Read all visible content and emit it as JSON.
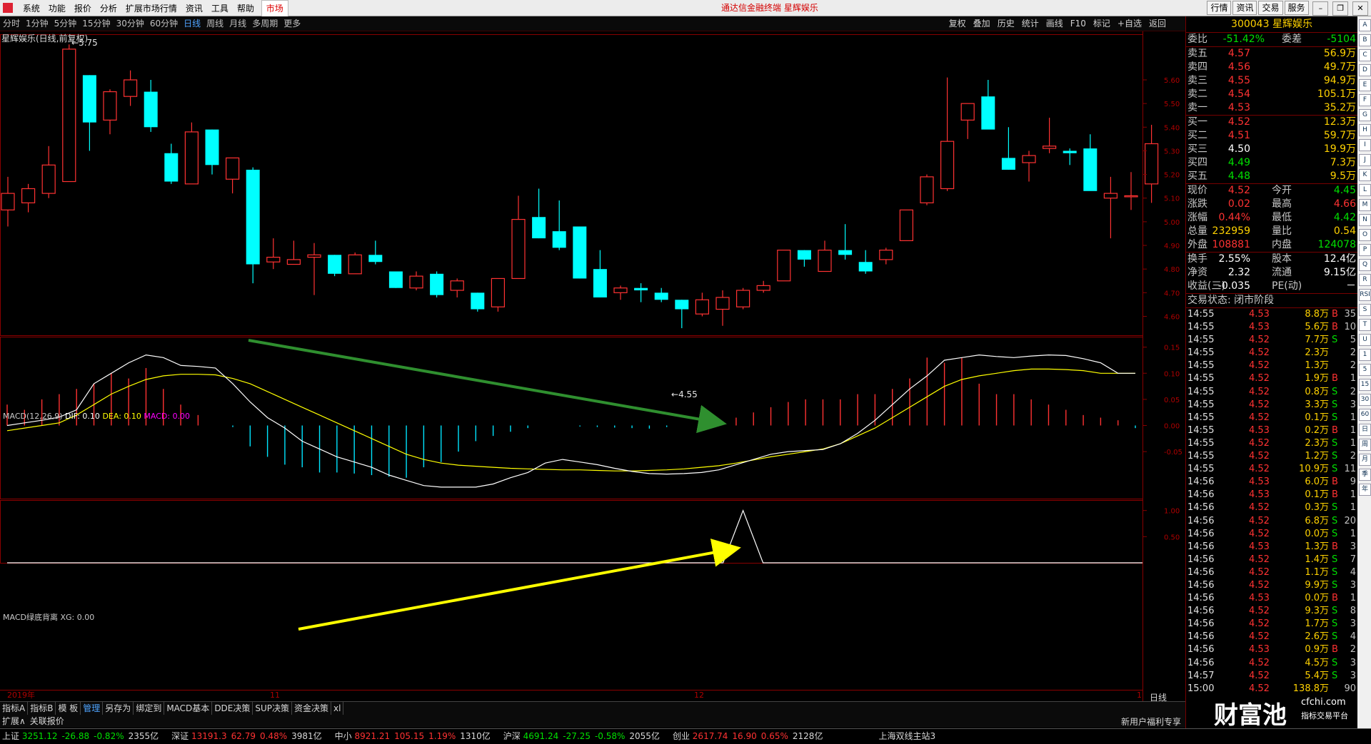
{
  "menubar": {
    "items": [
      "系统",
      "功能",
      "报价",
      "分析",
      "扩展市场行情",
      "资讯",
      "工具",
      "帮助"
    ],
    "market_label": "市场",
    "app_title": "通达信金融终端  星辉娱乐",
    "right_buttons": [
      "行情",
      "资讯",
      "交易",
      "服务"
    ]
  },
  "periodbar": {
    "items": [
      "分时",
      "1分钟",
      "5分钟",
      "15分钟",
      "30分钟",
      "60分钟",
      "日线",
      "周线",
      "月线",
      "多周期",
      "更多"
    ],
    "active_index": 6,
    "tools": [
      "复权",
      "叠加",
      "历史",
      "统计",
      "画线",
      "F10",
      "标记",
      "+自选",
      "返回"
    ]
  },
  "chart_header": {
    "stock_label": "星辉娱乐(日线,前复权)",
    "high_label": "5.75",
    "low_label": "4.55"
  },
  "chart_data": [
    {
      "type": "candlestick",
      "title": "星辉娱乐(日线,前复权)",
      "y_ticks": [
        "5.60",
        "5.50",
        "5.40",
        "5.30",
        "5.20",
        "5.10",
        "5.00",
        "4.90",
        "4.80",
        "4.70",
        "4.60"
      ],
      "ylim": [
        4.52,
        5.79
      ],
      "x_labels": [
        "2019年",
        "11",
        "12",
        "1"
      ],
      "candles": [
        {
          "o": 5.05,
          "h": 5.19,
          "l": 4.98,
          "c": 5.12
        },
        {
          "o": 5.08,
          "h": 5.16,
          "l": 5.04,
          "c": 5.14
        },
        {
          "o": 5.12,
          "h": 5.32,
          "l": 5.1,
          "c": 5.24
        },
        {
          "o": 5.17,
          "h": 5.75,
          "l": 5.17,
          "c": 5.73
        },
        {
          "o": 5.62,
          "h": 5.62,
          "l": 5.3,
          "c": 5.42
        },
        {
          "o": 5.43,
          "h": 5.56,
          "l": 5.37,
          "c": 5.55
        },
        {
          "o": 5.53,
          "h": 5.64,
          "l": 5.49,
          "c": 5.6
        },
        {
          "o": 5.55,
          "h": 5.6,
          "l": 5.38,
          "c": 5.4
        },
        {
          "o": 5.29,
          "h": 5.33,
          "l": 5.16,
          "c": 5.17
        },
        {
          "o": 5.16,
          "h": 5.42,
          "l": 5.16,
          "c": 5.38
        },
        {
          "o": 5.39,
          "h": 5.39,
          "l": 5.2,
          "c": 5.24
        },
        {
          "o": 5.18,
          "h": 5.27,
          "l": 5.12,
          "c": 5.27
        },
        {
          "o": 5.22,
          "h": 5.23,
          "l": 4.74,
          "c": 4.82
        },
        {
          "o": 4.83,
          "h": 4.93,
          "l": 4.8,
          "c": 4.85
        },
        {
          "o": 4.82,
          "h": 4.92,
          "l": 4.82,
          "c": 4.84
        },
        {
          "o": 4.85,
          "h": 4.91,
          "l": 4.69,
          "c": 4.86
        },
        {
          "o": 4.86,
          "h": 4.86,
          "l": 4.77,
          "c": 4.78
        },
        {
          "o": 4.78,
          "h": 4.87,
          "l": 4.78,
          "c": 4.86
        },
        {
          "o": 4.86,
          "h": 4.92,
          "l": 4.82,
          "c": 4.83
        },
        {
          "o": 4.79,
          "h": 4.79,
          "l": 4.72,
          "c": 4.72
        },
        {
          "o": 4.72,
          "h": 4.79,
          "l": 4.71,
          "c": 4.77
        },
        {
          "o": 4.78,
          "h": 4.79,
          "l": 4.68,
          "c": 4.69
        },
        {
          "o": 4.71,
          "h": 4.76,
          "l": 4.68,
          "c": 4.75
        },
        {
          "o": 4.7,
          "h": 4.7,
          "l": 4.62,
          "c": 4.63
        },
        {
          "o": 4.64,
          "h": 4.76,
          "l": 4.62,
          "c": 4.76
        },
        {
          "o": 4.76,
          "h": 5.11,
          "l": 4.76,
          "c": 5.01
        },
        {
          "o": 5.02,
          "h": 5.14,
          "l": 4.93,
          "c": 4.93
        },
        {
          "o": 4.96,
          "h": 5.09,
          "l": 4.88,
          "c": 4.89
        },
        {
          "o": 4.98,
          "h": 4.98,
          "l": 4.76,
          "c": 4.76
        },
        {
          "o": 4.8,
          "h": 4.88,
          "l": 4.68,
          "c": 4.68
        },
        {
          "o": 4.7,
          "h": 4.73,
          "l": 4.67,
          "c": 4.72
        },
        {
          "o": 4.72,
          "h": 4.74,
          "l": 4.66,
          "c": 4.71
        },
        {
          "o": 4.7,
          "h": 4.72,
          "l": 4.66,
          "c": 4.67
        },
        {
          "o": 4.67,
          "h": 4.67,
          "l": 4.55,
          "c": 4.63
        },
        {
          "o": 4.61,
          "h": 4.7,
          "l": 4.6,
          "c": 4.67
        },
        {
          "o": 4.63,
          "h": 4.71,
          "l": 4.56,
          "c": 4.68
        },
        {
          "o": 4.64,
          "h": 4.72,
          "l": 4.63,
          "c": 4.71
        },
        {
          "o": 4.71,
          "h": 4.75,
          "l": 4.7,
          "c": 4.73
        },
        {
          "o": 4.75,
          "h": 4.88,
          "l": 4.75,
          "c": 4.88
        },
        {
          "o": 4.88,
          "h": 4.88,
          "l": 4.81,
          "c": 4.84
        },
        {
          "o": 4.79,
          "h": 4.92,
          "l": 4.79,
          "c": 4.88
        },
        {
          "o": 4.88,
          "h": 4.99,
          "l": 4.84,
          "c": 4.86
        },
        {
          "o": 4.83,
          "h": 4.88,
          "l": 4.78,
          "c": 4.79
        },
        {
          "o": 4.84,
          "h": 4.89,
          "l": 4.82,
          "c": 4.88
        },
        {
          "o": 4.92,
          "h": 5.05,
          "l": 4.92,
          "c": 5.05
        },
        {
          "o": 5.08,
          "h": 5.2,
          "l": 5.07,
          "c": 5.19
        },
        {
          "o": 5.14,
          "h": 5.61,
          "l": 5.13,
          "c": 5.34
        },
        {
          "o": 5.43,
          "h": 5.49,
          "l": 5.35,
          "c": 5.5
        },
        {
          "o": 5.53,
          "h": 5.6,
          "l": 5.4,
          "c": 5.39
        },
        {
          "o": 5.27,
          "h": 5.4,
          "l": 5.22,
          "c": 5.22
        },
        {
          "o": 5.25,
          "h": 5.3,
          "l": 5.17,
          "c": 5.28
        },
        {
          "o": 5.31,
          "h": 5.44,
          "l": 5.29,
          "c": 5.32
        },
        {
          "o": 5.3,
          "h": 5.31,
          "l": 5.24,
          "c": 5.29
        },
        {
          "o": 5.31,
          "h": 5.37,
          "l": 5.16,
          "c": 5.13
        },
        {
          "o": 5.1,
          "h": 5.19,
          "l": 4.93,
          "c": 5.12
        },
        {
          "o": 5.11,
          "h": 5.21,
          "l": 5.05,
          "c": 5.11
        },
        {
          "o": 5.16,
          "h": 5.41,
          "l": 5.08,
          "c": 5.33
        }
      ],
      "annotations": [
        "5.75",
        "4.55"
      ]
    },
    {
      "type": "macd",
      "title": "MACD(12,26,9)",
      "dif_label": "DIF: 0.10",
      "dea_label": "DEA: 0.10",
      "macd_label": "MACD: 0.00",
      "y_ticks": [
        "0.15",
        "0.10",
        "0.05",
        "0.00",
        "-0.05"
      ],
      "ylim": [
        -0.14,
        0.17
      ],
      "dif": [
        0.0,
        0.005,
        0.01,
        0.016,
        0.03,
        0.08,
        0.1,
        0.12,
        0.135,
        0.13,
        0.115,
        0.113,
        0.11,
        0.08,
        0.045,
        0.015,
        -0.005,
        -0.03,
        -0.045,
        -0.06,
        -0.07,
        -0.08,
        -0.095,
        -0.105,
        -0.115,
        -0.118,
        -0.118,
        -0.118,
        -0.112,
        -0.1,
        -0.09,
        -0.072,
        -0.065,
        -0.07,
        -0.075,
        -0.082,
        -0.088,
        -0.092,
        -0.093,
        -0.092,
        -0.09,
        -0.085,
        -0.075,
        -0.065,
        -0.055,
        -0.05,
        -0.048,
        -0.046,
        -0.035,
        -0.015,
        0.01,
        0.04,
        0.07,
        0.095,
        0.125,
        0.13,
        0.135,
        0.132,
        0.13,
        0.133,
        0.135,
        0.134,
        0.128,
        0.12,
        0.1,
        0.1
      ],
      "dea": [
        -0.01,
        -0.005,
        0.0,
        0.005,
        0.02,
        0.04,
        0.06,
        0.075,
        0.088,
        0.095,
        0.098,
        0.098,
        0.097,
        0.09,
        0.08,
        0.065,
        0.05,
        0.035,
        0.02,
        0.005,
        -0.01,
        -0.025,
        -0.04,
        -0.055,
        -0.065,
        -0.072,
        -0.076,
        -0.078,
        -0.08,
        -0.082,
        -0.083,
        -0.084,
        -0.085,
        -0.085,
        -0.086,
        -0.087,
        -0.087,
        -0.086,
        -0.085,
        -0.083,
        -0.08,
        -0.077,
        -0.072,
        -0.066,
        -0.06,
        -0.055,
        -0.05,
        -0.045,
        -0.035,
        -0.02,
        -0.005,
        0.015,
        0.035,
        0.055,
        0.075,
        0.088,
        0.095,
        0.1,
        0.105,
        0.108,
        0.108,
        0.107,
        0.105,
        0.1,
        0.1,
        0.1
      ],
      "macd": [
        0.04,
        0.03,
        0.05,
        0.06,
        0.07,
        0.08,
        0.1,
        0.09,
        0.11,
        0.07,
        0.04,
        0.02,
        0.0,
        -0.003,
        -0.04,
        -0.06,
        -0.075,
        -0.08,
        -0.09,
        -0.09,
        -0.092,
        -0.095,
        -0.098,
        -0.1,
        -0.08,
        -0.07,
        -0.05,
        -0.03,
        -0.02,
        -0.012,
        -0.005,
        0.0,
        0.0,
        -0.002,
        -0.003,
        -0.004,
        -0.005,
        -0.006,
        -0.003,
        0.0,
        0.0,
        0.0,
        0.015,
        0.025,
        0.035,
        0.045,
        0.05,
        0.05,
        0.05,
        0.06,
        0.06,
        0.07,
        0.09,
        0.13,
        0.12,
        0.13,
        0.08,
        0.06,
        0.06,
        0.05,
        0.04,
        0.03,
        0.02,
        0.015,
        0.01,
        -0.005
      ],
      "dif_color": "#ffffff",
      "dea_color": "#ffff00",
      "macd_label_color": "#ff00ff"
    },
    {
      "type": "line",
      "title": "MACD绿底背离",
      "xg_label": "XG: 0.00",
      "y_ticks": [
        "1.00",
        "0.50"
      ],
      "ylim": [
        0,
        1.2
      ],
      "signal_index": 36
    }
  ],
  "bottom_axis": {
    "date_labels": [
      "2019年",
      "11",
      "12",
      "1"
    ],
    "period_label": "日线"
  },
  "quote": {
    "code": "300043",
    "name": "星辉娱乐",
    "weibi_label": "委比",
    "weibi_value": "-51.42%",
    "weicha_label": "委差",
    "weicha_value": "-5104",
    "asks": [
      {
        "label": "卖五",
        "price": "4.57",
        "vol": "56.9万"
      },
      {
        "label": "卖四",
        "price": "4.56",
        "vol": "49.7万"
      },
      {
        "label": "卖三",
        "price": "4.55",
        "vol": "94.9万"
      },
      {
        "label": "卖二",
        "price": "4.54",
        "vol": "105.1万"
      },
      {
        "label": "卖一",
        "price": "4.53",
        "vol": "35.2万"
      }
    ],
    "bids": [
      {
        "label": "买一",
        "price": "4.52",
        "vol": "12.3万"
      },
      {
        "label": "买二",
        "price": "4.51",
        "vol": "59.7万"
      },
      {
        "label": "买三",
        "price": "4.50",
        "vol": "19.9万"
      },
      {
        "label": "买四",
        "price": "4.49",
        "vol": "7.3万"
      },
      {
        "label": "买五",
        "price": "4.48",
        "vol": "9.5万"
      }
    ],
    "stats": [
      {
        "l1": "现价",
        "v1": "4.52",
        "l2": "今开",
        "v2": "4.45",
        "c1": "red",
        "c2": "grn"
      },
      {
        "l1": "涨跌",
        "v1": "0.02",
        "l2": "最高",
        "v2": "4.66",
        "c1": "red",
        "c2": "red"
      },
      {
        "l1": "涨幅",
        "v1": "0.44%",
        "l2": "最低",
        "v2": "4.42",
        "c1": "red",
        "c2": "grn"
      },
      {
        "l1": "总量",
        "v1": "232959",
        "l2": "量比",
        "v2": "0.54",
        "c1": "yel",
        "c2": "yel"
      },
      {
        "l1": "外盘",
        "v1": "108881",
        "l2": "内盘",
        "v2": "124078",
        "c1": "red",
        "c2": "grn"
      }
    ],
    "stats2": [
      {
        "l1": "换手",
        "v1": "2.55%",
        "l2": "股本",
        "v2": "12.4亿"
      },
      {
        "l1": "净资",
        "v1": "2.32",
        "l2": "流通",
        "v2": "9.15亿"
      },
      {
        "l1": "收益(三)",
        "v1": "-0.035",
        "l2": "PE(动)",
        "v2": "－"
      }
    ],
    "trade_status": "交易状态: 闭市阶段"
  },
  "ticks": [
    {
      "t": "14:55",
      "p": "4.53",
      "v": "8.8万",
      "d": "B",
      "n": "35"
    },
    {
      "t": "14:55",
      "p": "4.53",
      "v": "5.6万",
      "d": "B",
      "n": "10"
    },
    {
      "t": "14:55",
      "p": "4.52",
      "v": "7.7万",
      "d": "S",
      "n": "5"
    },
    {
      "t": "14:55",
      "p": "4.52",
      "v": "2.3万",
      "d": "",
      "n": "2"
    },
    {
      "t": "14:55",
      "p": "4.52",
      "v": "1.3万",
      "d": "",
      "n": "2"
    },
    {
      "t": "14:55",
      "p": "4.52",
      "v": "1.9万",
      "d": "B",
      "n": "1"
    },
    {
      "t": "14:55",
      "p": "4.52",
      "v": "0.8万",
      "d": "S",
      "n": "2"
    },
    {
      "t": "14:55",
      "p": "4.52",
      "v": "3.3万",
      "d": "S",
      "n": "3"
    },
    {
      "t": "14:55",
      "p": "4.52",
      "v": "0.1万",
      "d": "S",
      "n": "1"
    },
    {
      "t": "14:55",
      "p": "4.53",
      "v": "0.2万",
      "d": "B",
      "n": "1"
    },
    {
      "t": "14:55",
      "p": "4.52",
      "v": "2.3万",
      "d": "S",
      "n": "1"
    },
    {
      "t": "14:55",
      "p": "4.52",
      "v": "1.2万",
      "d": "S",
      "n": "2"
    },
    {
      "t": "14:55",
      "p": "4.52",
      "v": "10.9万",
      "d": "S",
      "n": "11"
    },
    {
      "t": "14:56",
      "p": "4.53",
      "v": "6.0万",
      "d": "B",
      "n": "9"
    },
    {
      "t": "14:56",
      "p": "4.53",
      "v": "0.1万",
      "d": "B",
      "n": "1"
    },
    {
      "t": "14:56",
      "p": "4.52",
      "v": "0.3万",
      "d": "S",
      "n": "1"
    },
    {
      "t": "14:56",
      "p": "4.52",
      "v": "6.8万",
      "d": "S",
      "n": "20"
    },
    {
      "t": "14:56",
      "p": "4.52",
      "v": "0.0万",
      "d": "S",
      "n": "1"
    },
    {
      "t": "14:56",
      "p": "4.53",
      "v": "1.3万",
      "d": "B",
      "n": "3"
    },
    {
      "t": "14:56",
      "p": "4.52",
      "v": "1.4万",
      "d": "S",
      "n": "7"
    },
    {
      "t": "14:56",
      "p": "4.52",
      "v": "1.1万",
      "d": "S",
      "n": "4"
    },
    {
      "t": "14:56",
      "p": "4.52",
      "v": "9.9万",
      "d": "S",
      "n": "3"
    },
    {
      "t": "14:56",
      "p": "4.53",
      "v": "0.0万",
      "d": "B",
      "n": "1"
    },
    {
      "t": "14:56",
      "p": "4.52",
      "v": "9.3万",
      "d": "S",
      "n": "8"
    },
    {
      "t": "14:56",
      "p": "4.52",
      "v": "1.7万",
      "d": "S",
      "n": "3"
    },
    {
      "t": "14:56",
      "p": "4.52",
      "v": "2.6万",
      "d": "S",
      "n": "4"
    },
    {
      "t": "14:56",
      "p": "4.53",
      "v": "0.9万",
      "d": "B",
      "n": "2"
    },
    {
      "t": "14:56",
      "p": "4.52",
      "v": "4.5万",
      "d": "S",
      "n": "3"
    },
    {
      "t": "14:57",
      "p": "4.52",
      "v": "5.4万",
      "d": "S",
      "n": "3"
    },
    {
      "t": "15:00",
      "p": "4.52",
      "v": "138.8万",
      "d": "",
      "n": "90"
    }
  ],
  "tabs_row1": [
    "指标A",
    "指标B",
    "模 板",
    "管理",
    "另存为",
    "绑定到",
    "MACD基本",
    "DDE决策",
    "SUP决策",
    "资金决策",
    "xl"
  ],
  "tabs_row1_selected": 3,
  "tabs_row2": [
    "扩展∧",
    "关联报价"
  ],
  "status": {
    "items": [
      {
        "name": "上证",
        "value": "3251.12",
        "chg": "-26.88",
        "pct": "-0.82%",
        "amt": "2355亿",
        "up": false
      },
      {
        "name": "深证",
        "value": "13191.3",
        "chg": "62.79",
        "pct": "0.48%",
        "amt": "3981亿",
        "up": true
      },
      {
        "name": "中小",
        "value": "8921.21",
        "chg": "105.15",
        "pct": "1.19%",
        "amt": "1310亿",
        "up": true
      },
      {
        "name": "沪深",
        "value": "4691.24",
        "chg": "-27.25",
        "pct": "-0.58%",
        "amt": "2055亿",
        "up": false
      },
      {
        "name": "创业",
        "value": "2617.74",
        "chg": "16.90",
        "pct": "0.65%",
        "amt": "2128亿",
        "up": true
      }
    ],
    "server": "上海双线主站3",
    "promo": "新用户福利专享",
    "watermark": "财富池",
    "watermark_sub": "cfchi.com",
    "watermark_sub2": "指标交易平台"
  },
  "icon_strip": [
    "A",
    "B",
    "C",
    "D",
    "E",
    "F",
    "G",
    "H",
    "I",
    "J",
    "K",
    "L",
    "M",
    "N",
    "O",
    "P",
    "Q",
    "R",
    "RSI",
    "S",
    "T",
    "U",
    "1",
    "5",
    "15",
    "30",
    "60",
    "日",
    "周",
    "月",
    "季",
    "年"
  ],
  "colors": {
    "up": "#ff3232",
    "down": "#00ffff",
    "dif": "#ffffff",
    "dea": "#ffff00",
    "arrow_green": "#2f8f2f",
    "arrow_yellow": "#ffff00",
    "signal": "#ffffff"
  }
}
